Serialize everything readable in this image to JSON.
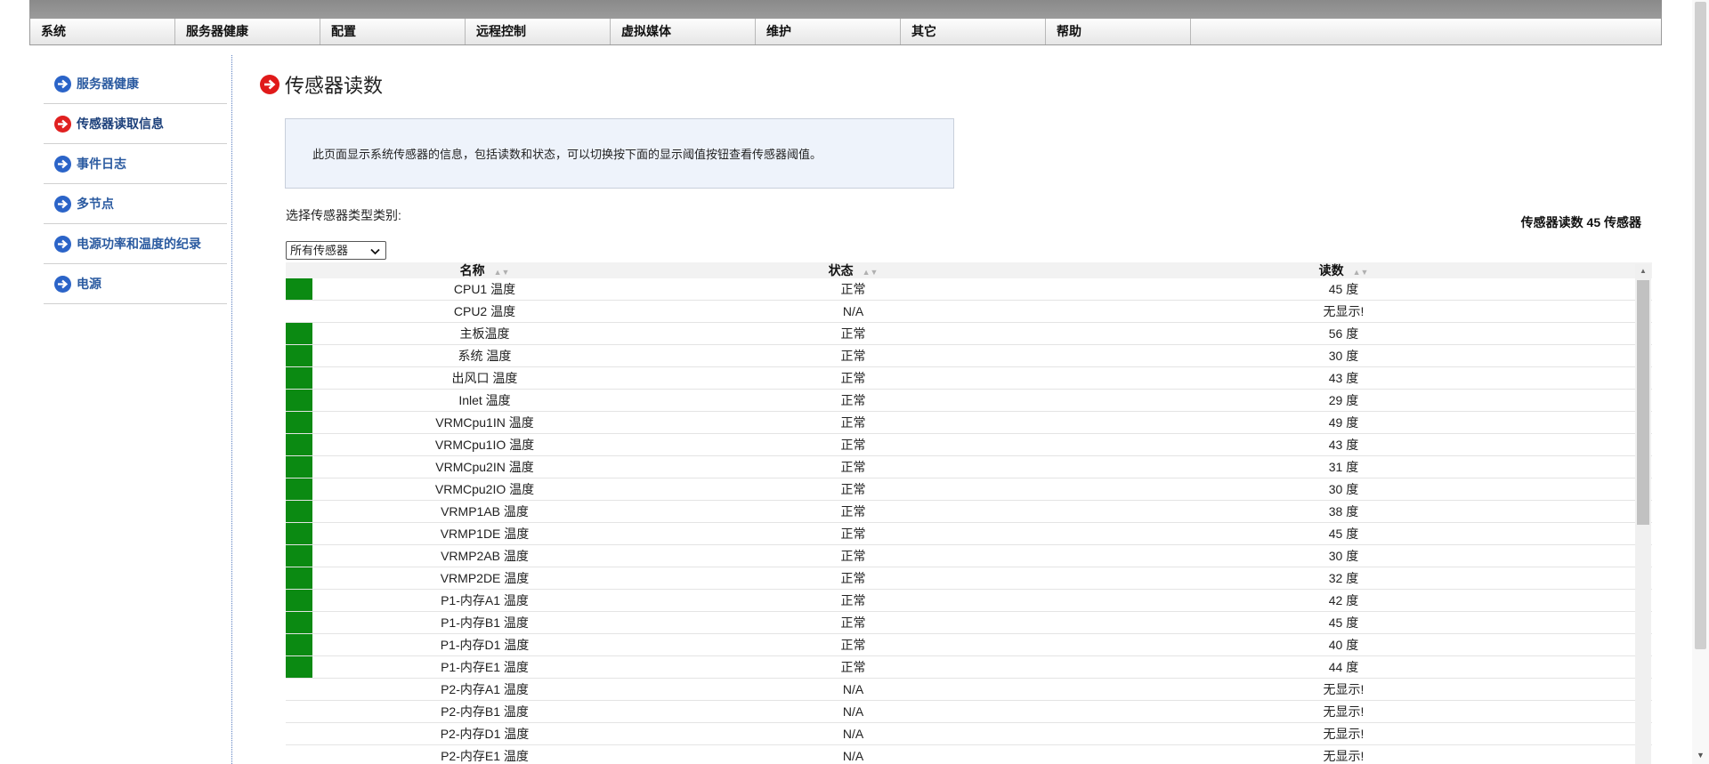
{
  "menu": [
    "系统",
    "服务器健康",
    "配置",
    "远程控制",
    "虚拟媒体",
    "维护",
    "其它",
    "帮助"
  ],
  "sidebar": {
    "items": [
      {
        "label": "服务器健康",
        "active": false
      },
      {
        "label": "传感器读取信息",
        "active": true
      },
      {
        "label": "事件日志",
        "active": false
      },
      {
        "label": "多节点",
        "active": false
      },
      {
        "label": "电源功率和温度的纪录",
        "active": false
      },
      {
        "label": "电源",
        "active": false
      }
    ]
  },
  "page": {
    "title": "传感器读数",
    "info": "此页面显示系统传感器的信息，包括读数和状态，可以切换按下面的显示阈值按钮查看传感器阈值。",
    "select_label": "选择传感器类型类别:",
    "select_value": "所有传感器",
    "sensor_count": "传感器读数 45 传感器"
  },
  "table": {
    "headers": {
      "name": "名称",
      "status": "状态",
      "reading": "读数"
    },
    "rows": [
      {
        "name": "CPU1 温度",
        "status": "正常",
        "reading": "45 度",
        "ok": true
      },
      {
        "name": "CPU2 温度",
        "status": "N/A",
        "reading": "无显示!",
        "ok": false
      },
      {
        "name": "主板温度",
        "status": "正常",
        "reading": "56 度",
        "ok": true
      },
      {
        "name": "系统 温度",
        "status": "正常",
        "reading": "30 度",
        "ok": true
      },
      {
        "name": "出风口 温度",
        "status": "正常",
        "reading": "43 度",
        "ok": true
      },
      {
        "name": "Inlet 温度",
        "status": "正常",
        "reading": "29 度",
        "ok": true
      },
      {
        "name": "VRMCpu1IN 温度",
        "status": "正常",
        "reading": "49 度",
        "ok": true
      },
      {
        "name": "VRMCpu1IO 温度",
        "status": "正常",
        "reading": "43 度",
        "ok": true
      },
      {
        "name": "VRMCpu2IN 温度",
        "status": "正常",
        "reading": "31 度",
        "ok": true
      },
      {
        "name": "VRMCpu2IO 温度",
        "status": "正常",
        "reading": "30 度",
        "ok": true
      },
      {
        "name": "VRMP1AB 温度",
        "status": "正常",
        "reading": "38 度",
        "ok": true
      },
      {
        "name": "VRMP1DE 温度",
        "status": "正常",
        "reading": "45 度",
        "ok": true
      },
      {
        "name": "VRMP2AB 温度",
        "status": "正常",
        "reading": "30 度",
        "ok": true
      },
      {
        "name": "VRMP2DE 温度",
        "status": "正常",
        "reading": "32 度",
        "ok": true
      },
      {
        "name": "P1-内存A1 温度",
        "status": "正常",
        "reading": "42 度",
        "ok": true
      },
      {
        "name": "P1-内存B1 温度",
        "status": "正常",
        "reading": "45 度",
        "ok": true
      },
      {
        "name": "P1-内存D1 温度",
        "status": "正常",
        "reading": "40 度",
        "ok": true
      },
      {
        "name": "P1-内存E1 温度",
        "status": "正常",
        "reading": "44 度",
        "ok": true
      },
      {
        "name": "P2-内存A1 温度",
        "status": "N/A",
        "reading": "无显示!",
        "ok": false
      },
      {
        "name": "P2-内存B1 温度",
        "status": "N/A",
        "reading": "无显示!",
        "ok": false
      },
      {
        "name": "P2-内存D1 温度",
        "status": "N/A",
        "reading": "无显示!",
        "ok": false
      },
      {
        "name": "P2-内存E1 温度",
        "status": "N/A",
        "reading": "无显示!",
        "ok": false
      }
    ]
  },
  "colors": {
    "ok_indicator": "#0b8a12",
    "active_arrow": "#e02020",
    "nav_arrow": "#2b64c8",
    "info_bg": "#eef3fb"
  },
  "icons": {
    "nav": "arrow-right-circle-icon",
    "sort": "sort-arrows-icon",
    "select": "chevron-down-icon"
  }
}
